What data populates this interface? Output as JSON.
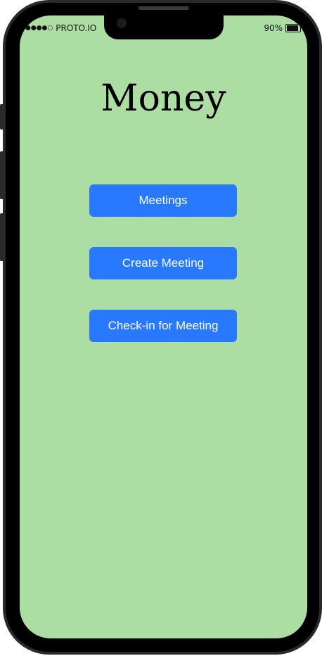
{
  "status_bar": {
    "signal": "●●●●○",
    "carrier": "PROTO.IO",
    "battery": "90%",
    "battery_level": 0.9
  },
  "main": {
    "title": "Money",
    "buttons": [
      {
        "label": "Meetings"
      },
      {
        "label": "Create Meeting"
      },
      {
        "label": "Check-in for Meeting"
      }
    ]
  },
  "colors": {
    "screen_background": "#acdea4",
    "button": "#2979ff",
    "button_text": "#ffffff"
  }
}
